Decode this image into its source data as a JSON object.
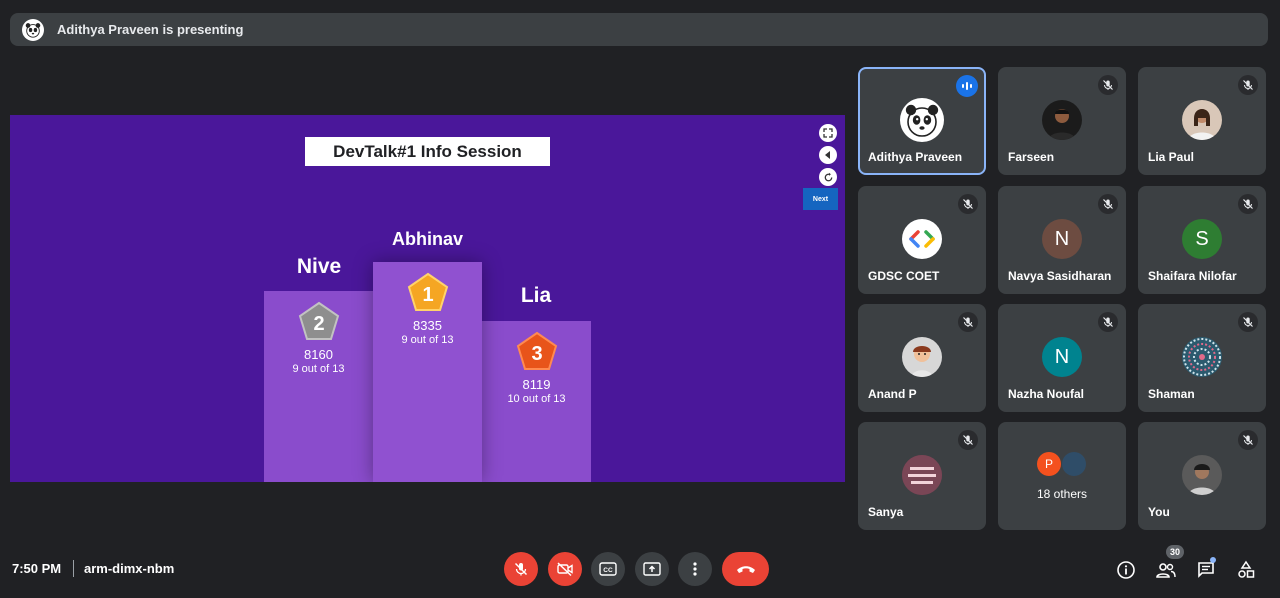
{
  "banner": {
    "text": "Adithya Praveen is presenting"
  },
  "slide": {
    "title": "DevTalk#1 Info Session",
    "next_label": "Next",
    "podium": [
      {
        "name": "Abhinav",
        "rank": "1",
        "score": "8335",
        "correct": "9 out of 13"
      },
      {
        "name": "Nive",
        "rank": "2",
        "score": "8160",
        "correct": "9 out of 13"
      },
      {
        "name": "Lia",
        "rank": "3",
        "score": "8119",
        "correct": "10 out of 13"
      }
    ]
  },
  "participants": [
    {
      "name": "Adithya Praveen",
      "icon": "panda-avatar",
      "speaking": true
    },
    {
      "name": "Farseen",
      "icon": "photo-avatar",
      "muted": true
    },
    {
      "name": "Lia Paul",
      "icon": "photo-avatar",
      "muted": true
    },
    {
      "name": "GDSC COET",
      "icon": "gdsc-logo-avatar",
      "muted": true
    },
    {
      "name": "Navya Sasidharan",
      "initial": "N",
      "color": "#6d4c41",
      "muted": true
    },
    {
      "name": "Shaifara Nilofar",
      "initial": "S",
      "color": "#2e7d32",
      "muted": true
    },
    {
      "name": "Anand P",
      "icon": "cartoon-avatar",
      "muted": true
    },
    {
      "name": "Nazha Noufal",
      "initial": "N",
      "color": "#00838f",
      "muted": true
    },
    {
      "name": "Shaman",
      "icon": "pattern-avatar",
      "muted": true
    },
    {
      "name": "Sanya",
      "icon": "photo-avatar",
      "muted": true
    },
    {
      "name": "You",
      "icon": "photo-avatar",
      "muted": true
    }
  ],
  "others": {
    "initial": "P",
    "label": "18 others"
  },
  "footer": {
    "time": "7:50 PM",
    "meeting_code": "arm-dimx-nbm",
    "people_count": "30"
  },
  "colors": {
    "end_call": "#ea4335",
    "accent": "#8ab4f8",
    "slide_bg": "#4a179a"
  }
}
